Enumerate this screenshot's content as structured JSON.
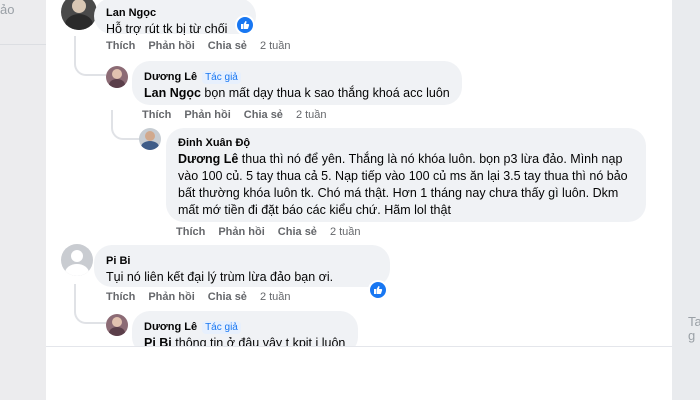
{
  "background": {
    "left_stub_text": "ảo"
  },
  "right_edge_text": {
    "r1": "Ta",
    "r2": "g"
  },
  "comments": {
    "c1": {
      "author": "Lan Ngọc",
      "text": "Hỗ trợ rút tk bị từ chối",
      "actions": {
        "like": "Thích",
        "reply": "Phản hồi",
        "share": "Chia sẻ"
      },
      "time": "2 tuần",
      "reaction_icon": "like-icon"
    },
    "c2": {
      "author": "Dương Lê",
      "badge": "Tác giả",
      "mention": "Lan Ngọc",
      "text": " bọn mất dạy thua k sao thắng khoá acc luôn",
      "actions": {
        "like": "Thích",
        "reply": "Phản hồi",
        "share": "Chia sẻ"
      },
      "time": "2 tuần"
    },
    "c3": {
      "author": "Đinh Xuân Độ",
      "mention": "Dương Lê",
      "line1": " thua thì nó để yên. Thắng là nó khóa luôn. bọn p3 lừa đảo. Mình nạp",
      "line2": "vào 100 củ. 5 tay thua cả 5. Nạp tiếp vào 100 củ ms ăn lại 3.5 tay thua thì nó bảo",
      "line3": "bất thường khóa luôn tk. Chó má thật. Hơn 1 tháng nay chưa thấy gì luôn. Dkm",
      "line4": "mất mớ tiền đi đặt báo các kiểu chứ. Hãm lol thật",
      "actions": {
        "like": "Thích",
        "reply": "Phản hồi",
        "share": "Chia sẻ"
      },
      "time": "2 tuần"
    },
    "c4": {
      "author": "Pi Bi",
      "text": "Tụi nó liên kết đại lý trùm lừa đảo bạn ơi.",
      "actions": {
        "like": "Thích",
        "reply": "Phản hồi",
        "share": "Chia sẻ"
      },
      "time": "2 tuần",
      "reaction_icon": "like-icon"
    },
    "c5": {
      "author": "Dương Lê",
      "badge": "Tác giả",
      "mention": "Pi Bi",
      "text": " thông tin ở đâu vậy t kpit j luôn"
    }
  },
  "colors": {
    "link_blue": "#1877f2",
    "bubble": "#f0f2f5",
    "meta_gray": "#65676b"
  }
}
